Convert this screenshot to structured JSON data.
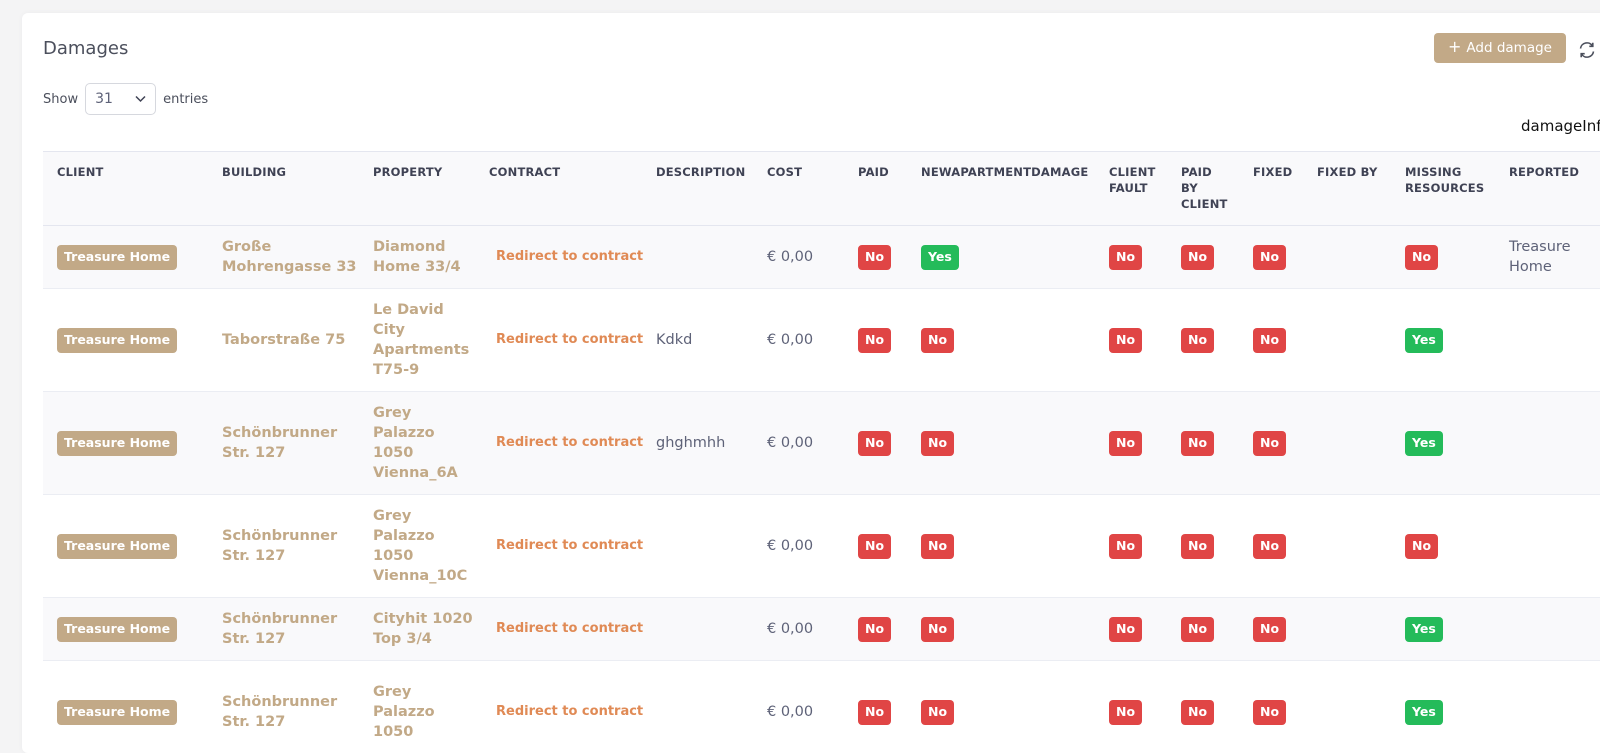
{
  "header": {
    "title": "Damages",
    "add_label": "Add damage"
  },
  "show": {
    "prefix": "Show",
    "value": "31",
    "suffix": "entries"
  },
  "damageinfo_label": "damageInf",
  "columns": [
    "CLIENT",
    "BUILDING",
    "PROPERTY",
    "CONTRACT",
    "DESCRIPTION",
    "COST",
    "PAID",
    "NEWAPARTMENTDAMAGE",
    "CLIENT\nFAULT",
    "PAID\nBY\nCLIENT",
    "FIXED",
    "FIXED BY",
    "MISSING\nRESOURCES",
    "REPORTED"
  ],
  "rows": [
    {
      "client": "Treasure Home",
      "building": "Große\nMohrengasse 33",
      "property": "Diamond\nHome 33/4",
      "contract": "Redirect to contract",
      "description": "",
      "cost": "€ 0,00",
      "paid": "No",
      "new_apartment_damage": "Yes",
      "client_fault": "No",
      "paid_by_client": "No",
      "fixed": "No",
      "fixed_by": "",
      "missing_resources": "No",
      "reported": "Treasure\nHome"
    },
    {
      "client": "Treasure Home",
      "building": "Taborstraße 75",
      "property": "Le David\nCity\nApartments\nT75-9",
      "contract": "Redirect to contract",
      "description": "Kdkd",
      "cost": "€ 0,00",
      "paid": "No",
      "new_apartment_damage": "No",
      "client_fault": "No",
      "paid_by_client": "No",
      "fixed": "No",
      "fixed_by": "",
      "missing_resources": "Yes",
      "reported": ""
    },
    {
      "client": "Treasure Home",
      "building": "Schönbrunner\nStr. 127",
      "property": "Grey\nPalazzo\n1050\nVienna_6A",
      "contract": "Redirect to contract",
      "description": "ghghmhh",
      "cost": "€ 0,00",
      "paid": "No",
      "new_apartment_damage": "No",
      "client_fault": "No",
      "paid_by_client": "No",
      "fixed": "No",
      "fixed_by": "",
      "missing_resources": "Yes",
      "reported": ""
    },
    {
      "client": "Treasure Home",
      "building": "Schönbrunner\nStr. 127",
      "property": "Grey\nPalazzo\n1050\nVienna_10C",
      "contract": "Redirect to contract",
      "description": "",
      "cost": "€ 0,00",
      "paid": "No",
      "new_apartment_damage": "No",
      "client_fault": "No",
      "paid_by_client": "No",
      "fixed": "No",
      "fixed_by": "",
      "missing_resources": "No",
      "reported": ""
    },
    {
      "client": "Treasure Home",
      "building": "Schönbrunner\nStr. 127",
      "property": "Cityhit 1020\nTop 3/4",
      "contract": "Redirect to contract",
      "description": "",
      "cost": "€ 0,00",
      "paid": "No",
      "new_apartment_damage": "No",
      "client_fault": "No",
      "paid_by_client": "No",
      "fixed": "No",
      "fixed_by": "",
      "missing_resources": "Yes",
      "reported": ""
    },
    {
      "client": "Treasure Home",
      "building": "Schönbrunner\nStr. 127",
      "property": "Grey\nPalazzo\n1050",
      "contract": "Redirect to contract",
      "description": "",
      "cost": "€ 0,00",
      "paid": "No",
      "new_apartment_damage": "No",
      "client_fault": "No",
      "paid_by_client": "No",
      "fixed": "No",
      "fixed_by": "",
      "missing_resources": "Yes",
      "reported": ""
    }
  ],
  "colors": {
    "accent": "#c2a987",
    "link": "#e08a55",
    "no": "#e04545",
    "yes": "#24bb5a"
  },
  "icons": {
    "add": "plus-icon",
    "refresh": "refresh-icon",
    "select": "chevron-down-icon"
  }
}
